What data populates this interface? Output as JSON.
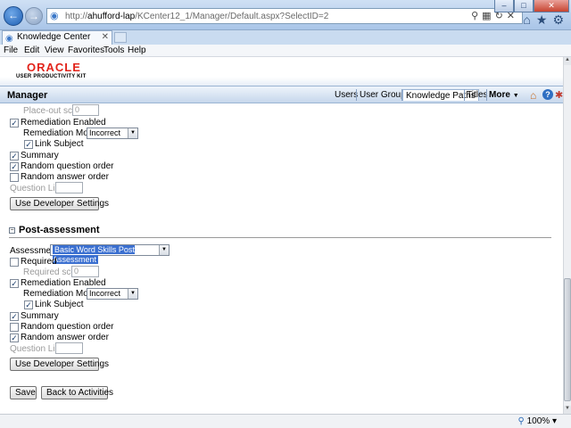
{
  "browser": {
    "url_prefix": "http://",
    "url_host": "ahufford-lap",
    "url_path": "/KCenter12_1/Manager/Default.aspx?SelectID=2",
    "tab_title": "Knowledge Center",
    "menu": [
      "File",
      "Edit",
      "View",
      "Favorites",
      "Tools",
      "Help"
    ],
    "zoom": "100%"
  },
  "header": {
    "brand": "ORACLE",
    "product": "USER PRODUCTIVITY KIT"
  },
  "manager_bar": {
    "title": "Manager",
    "tabs": [
      "Users",
      "User Groups",
      "Knowledge Paths",
      "Titles",
      "More"
    ]
  },
  "pre": {
    "place_out_label": "Place-out score:",
    "place_out_value": "0",
    "remediation_label": "Remediation Enabled",
    "modes_label": "Remediation Modes:",
    "modes_value": "Incorrect",
    "link_subject_label": "Link Subject",
    "summary_label": "Summary",
    "random_q_label": "Random question order",
    "random_a_label": "Random answer order",
    "question_limit_label": "Question Limit:",
    "dev_button": "Use Developer Settings"
  },
  "post": {
    "heading": "Post-assessment",
    "assessment_label": "Assessment:",
    "assessment_value": "Basic Word Skills Post Assessment",
    "required_label": "Required",
    "required_score_label": "Required score:",
    "required_score_value": "0",
    "remediation_label": "Remediation Enabled",
    "modes_label": "Remediation Modes:",
    "modes_value": "Incorrect",
    "link_subject_label": "Link Subject",
    "summary_label": "Summary",
    "random_q_label": "Random question order",
    "random_a_label": "Random answer order",
    "question_limit_label": "Question Limit:",
    "dev_button": "Use Developer Settings"
  },
  "footer_buttons": {
    "save": "Save",
    "back": "Back to Activities"
  }
}
